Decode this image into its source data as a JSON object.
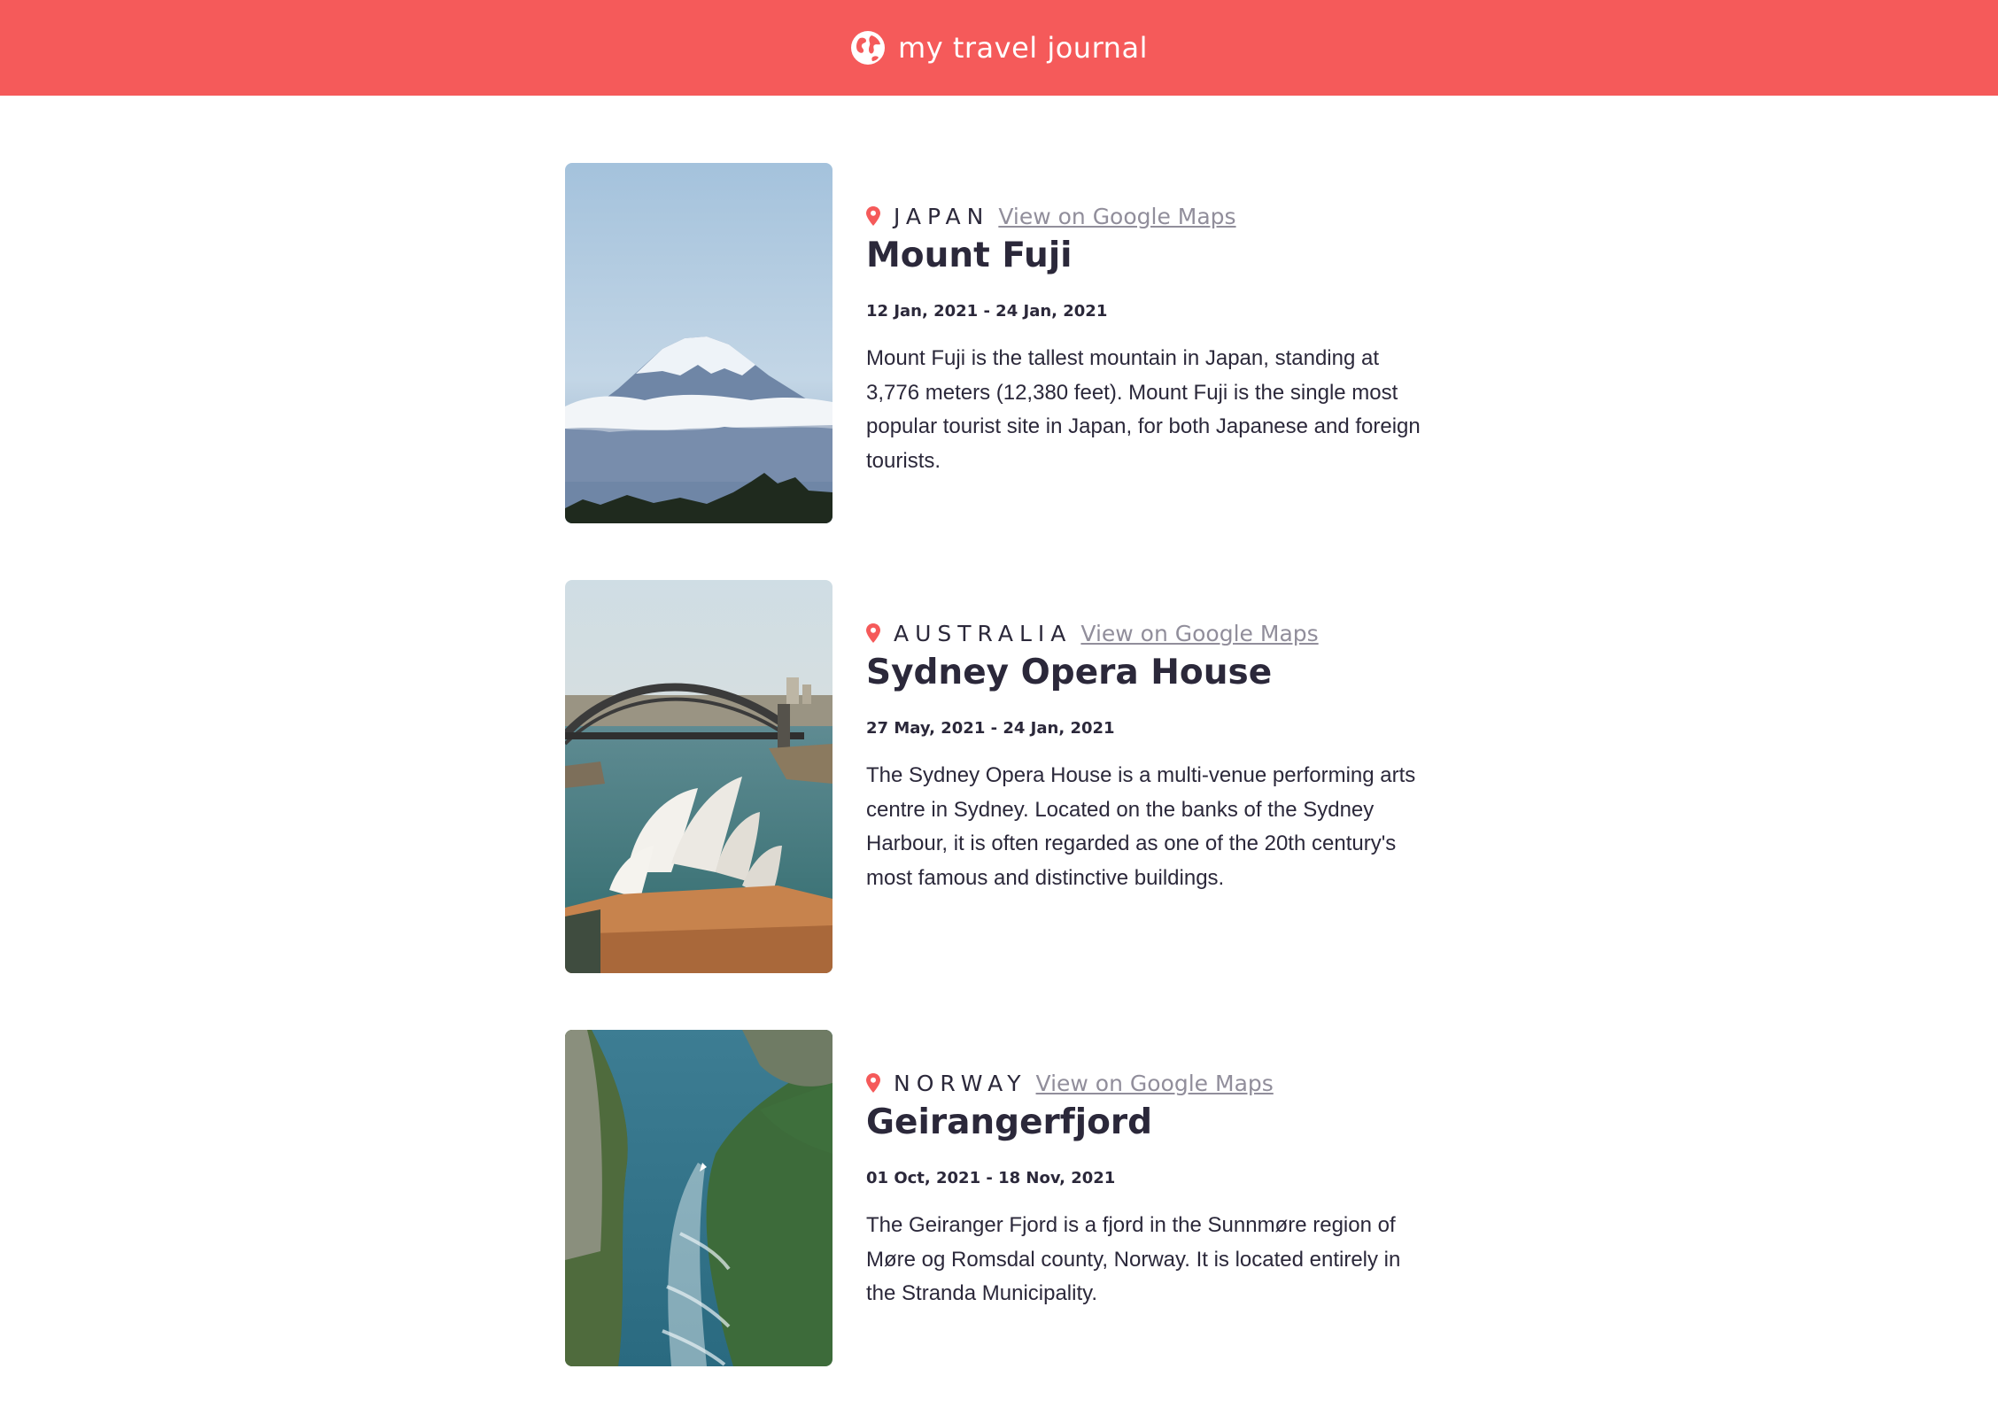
{
  "header": {
    "title": "my travel journal",
    "icon": "globe-icon",
    "background": "#f55a5a"
  },
  "entries": [
    {
      "country": "JAPAN",
      "maps_label": "View on Google Maps",
      "title": "Mount Fuji",
      "dates": "12 Jan, 2021 - 24 Jan, 2021",
      "description": "Mount Fuji is the tallest mountain in Japan, standing at 3,776 meters (12,380 feet). Mount Fuji is the single most popular tourist site in Japan, for both Japanese and foreign tourists."
    },
    {
      "country": "AUSTRALIA",
      "maps_label": "View on Google Maps",
      "title": "Sydney Opera House",
      "dates": "27 May, 2021 - 24 Jan, 2021",
      "description": "The Sydney Opera House is a multi-venue performing arts centre in Sydney. Located on the banks of the Sydney Harbour, it is often regarded as one of the 20th century's most famous and distinctive buildings."
    },
    {
      "country": "NORWAY",
      "maps_label": "View on Google Maps",
      "title": "Geirangerfjord",
      "dates": "01 Oct, 2021 - 18 Nov, 2021",
      "description": "The Geiranger Fjord is a fjord in the Sunnmøre region of Møre og Romsdal county, Norway. It is located entirely in the Stranda Municipality."
    }
  ],
  "colors": {
    "accent": "#f55a5a",
    "text": "#2b283a",
    "link": "#918e9b"
  }
}
